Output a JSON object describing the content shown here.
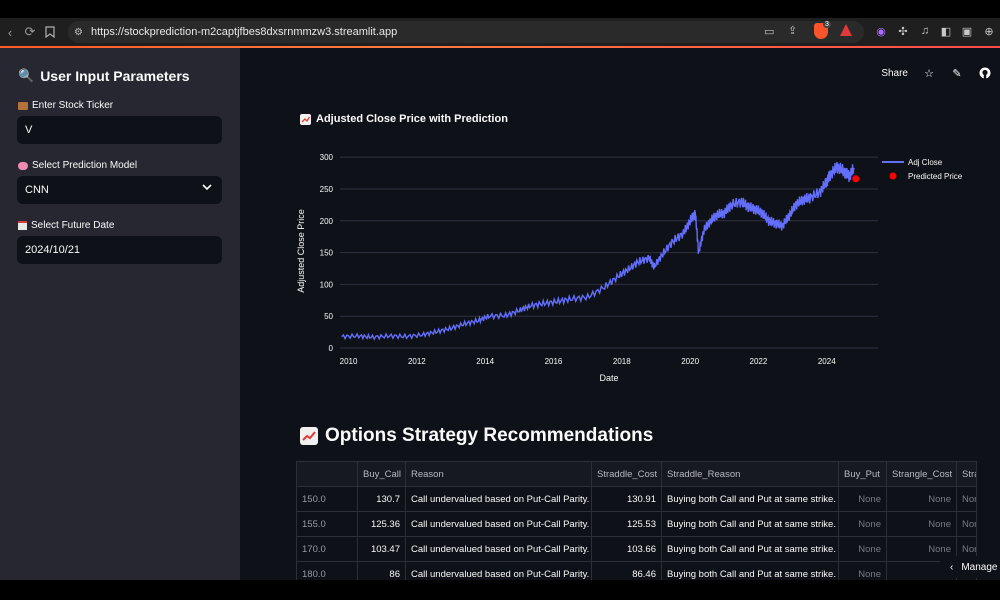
{
  "browser": {
    "url": "https://stockprediction-m2captjfbes8dxsrnmmzw3.streamlit.app",
    "shield_badge": "3"
  },
  "sidebar": {
    "title": "User Input Parameters",
    "ticker_label": "Enter Stock Ticker",
    "ticker_value": "V",
    "model_label": "Select Prediction Model",
    "model_value": "CNN",
    "date_label": "Select Future Date",
    "date_value": "2024/10/21"
  },
  "header": {
    "share_label": "Share"
  },
  "chart_section": {
    "title": "Adjusted Close Price with Prediction"
  },
  "chart_data": {
    "type": "line",
    "title": "",
    "xlabel": "Date",
    "ylabel": "Adjusted Close Price",
    "xlim": [
      2009.75,
      2025.5
    ],
    "ylim": [
      0,
      305
    ],
    "x_ticks": [
      "2010",
      "2012",
      "2014",
      "2016",
      "2018",
      "2020",
      "2022",
      "2024"
    ],
    "y_ticks": [
      "0",
      "50",
      "100",
      "150",
      "200",
      "250",
      "300"
    ],
    "grid": true,
    "legend": "right",
    "series": [
      {
        "name": "Adj Close",
        "color": "#636efa",
        "x": [
          2009.8,
          2010.3,
          2010.7,
          2011.2,
          2011.7,
          2012.2,
          2012.6,
          2013.0,
          2013.4,
          2013.8,
          2014.1,
          2014.6,
          2015.0,
          2015.3,
          2015.7,
          2016.1,
          2016.5,
          2017.0,
          2017.5,
          2017.9,
          2018.2,
          2018.5,
          2018.8,
          2018.95,
          2019.2,
          2019.5,
          2019.8,
          2020.0,
          2020.15,
          2020.25,
          2020.4,
          2020.6,
          2020.8,
          2021.0,
          2021.2,
          2021.5,
          2021.7,
          2021.9,
          2022.1,
          2022.3,
          2022.5,
          2022.7,
          2022.9,
          2023.1,
          2023.3,
          2023.5,
          2023.8,
          2024.0,
          2024.1,
          2024.3,
          2024.5,
          2024.65,
          2024.8
        ],
        "y": [
          18,
          19,
          17,
          19,
          18,
          21,
          26,
          31,
          38,
          43,
          50,
          51,
          59,
          66,
          70,
          73,
          77,
          80,
          96,
          113,
          124,
          136,
          141,
          128,
          148,
          168,
          180,
          200,
          212,
          150,
          185,
          200,
          210,
          212,
          225,
          230,
          222,
          218,
          213,
          200,
          196,
          192,
          208,
          226,
          233,
          236,
          245,
          262,
          272,
          285,
          278,
          270,
          283
        ]
      },
      {
        "name": "Predicted Price",
        "color": "#ff0000",
        "x": [
          2024.85
        ],
        "y": [
          266
        ]
      }
    ]
  },
  "options_section": {
    "title": "Options Strategy Recommendations",
    "columns": [
      "",
      "Buy_Call",
      "Reason",
      "Straddle_Cost",
      "Straddle_Reason",
      "Buy_Put",
      "Strangle_Cost",
      "Stra"
    ],
    "rows": [
      [
        "150.0",
        "130.7",
        "Call undervalued based on Put-Call Parity.",
        "130.91",
        "Buying both Call and Put at same strike.",
        "None",
        "None",
        "Non"
      ],
      [
        "155.0",
        "125.36",
        "Call undervalued based on Put-Call Parity.",
        "125.53",
        "Buying both Call and Put at same strike.",
        "None",
        "None",
        "Non"
      ],
      [
        "170.0",
        "103.47",
        "Call undervalued based on Put-Call Parity.",
        "103.66",
        "Buying both Call and Put at same strike.",
        "None",
        "None",
        "Non"
      ],
      [
        "180.0",
        "86",
        "Call undervalued based on Put-Call Parity.",
        "86.46",
        "Buying both Call and Put at same strike.",
        "None",
        "N",
        "Non"
      ]
    ]
  },
  "footer": {
    "manage_label": "Manage"
  }
}
